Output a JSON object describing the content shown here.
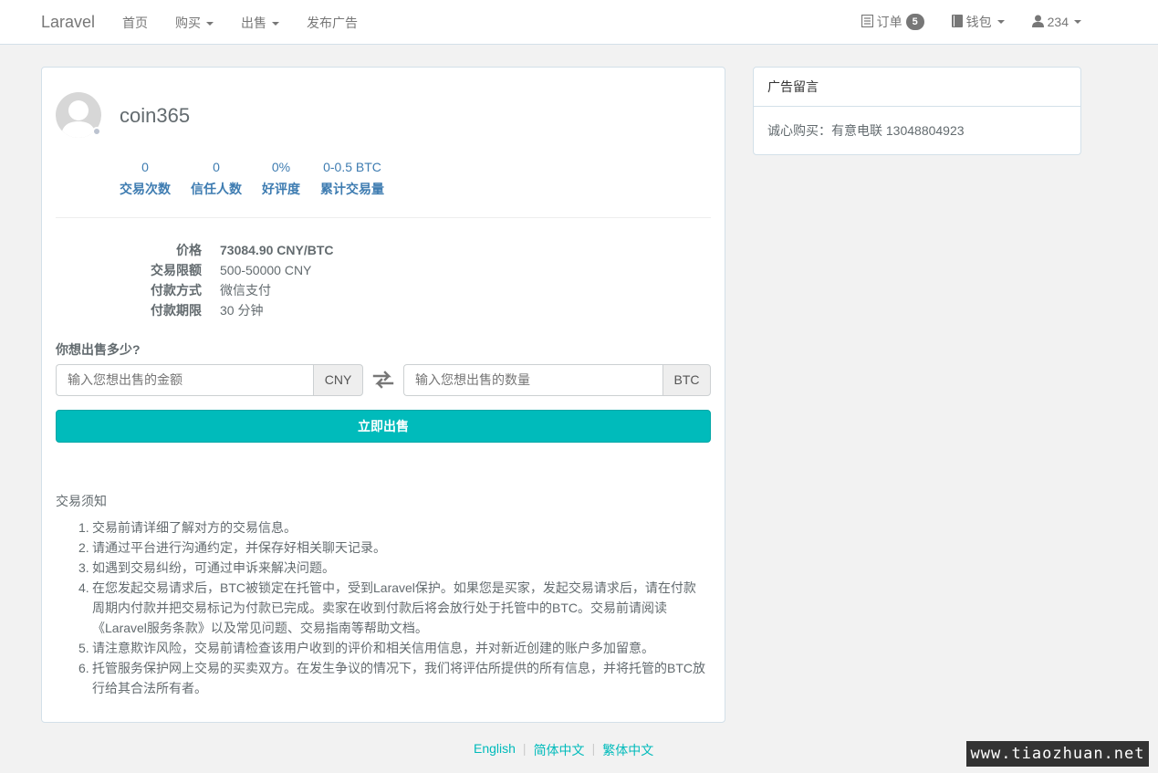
{
  "navbar": {
    "brand": "Laravel",
    "left_items": [
      {
        "label": "首页",
        "dropdown": false
      },
      {
        "label": "购买",
        "dropdown": true
      },
      {
        "label": "出售",
        "dropdown": true
      },
      {
        "label": "发布广告",
        "dropdown": false
      }
    ],
    "orders": {
      "label": "订单",
      "count": "5",
      "icon": "list-icon"
    },
    "wallet": {
      "label": "钱包",
      "icon": "book-icon"
    },
    "user": {
      "label": "234",
      "icon": "user-icon"
    }
  },
  "profile": {
    "username": "coin365",
    "stats": [
      {
        "value": "0",
        "label": "交易次数"
      },
      {
        "value": "0",
        "label": "信任人数"
      },
      {
        "value": "0%",
        "label": "好评度"
      },
      {
        "value": "0-0.5 BTC",
        "label": "累计交易量"
      }
    ]
  },
  "details": {
    "price_label": "价格",
    "price_value": "73084.90 CNY/BTC",
    "limit_label": "交易限额",
    "limit_value": "500-50000 CNY",
    "payment_label": "付款方式",
    "payment_value": "微信支付",
    "period_label": "付款期限",
    "period_value": "30 分钟"
  },
  "sell_form": {
    "question": "你想出售多少?",
    "amount_placeholder": "输入您想出售的金额",
    "amount_unit": "CNY",
    "quantity_placeholder": "输入您想出售的数量",
    "quantity_unit": "BTC",
    "submit_label": "立即出售"
  },
  "notice": {
    "title": "交易须知",
    "items": [
      "交易前请详细了解对方的交易信息。",
      "请通过平台进行沟通约定，并保存好相关聊天记录。",
      "如遇到交易纠纷，可通过申诉来解决问题。",
      "在您发起交易请求后，BTC被锁定在托管中，受到Laravel保护。如果您是买家，发起交易请求后，请在付款周期内付款并把交易标记为付款已完成。卖家在收到付款后将会放行处于托管中的BTC。交易前请阅读《Laravel服务条款》以及常见问题、交易指南等帮助文档。",
      "请注意欺诈风险，交易前请检查该用户收到的评价和相关信用信息，并对新近创建的账户多加留意。",
      "托管服务保护网上交易的买卖双方。在发生争议的情况下，我们将评估所提供的所有信息，并将托管的BTC放行给其合法所有者。"
    ]
  },
  "ad_message": {
    "title": "广告留言",
    "body": "诚心购买：有意电联 13048804923"
  },
  "footer": {
    "languages": [
      "English",
      "简体中文",
      "繁体中文"
    ]
  },
  "watermark": "www.tiaozhuan.net",
  "colors": {
    "accent": "#00bbbb",
    "link": "#3e7cb1",
    "badge": "#777777"
  }
}
